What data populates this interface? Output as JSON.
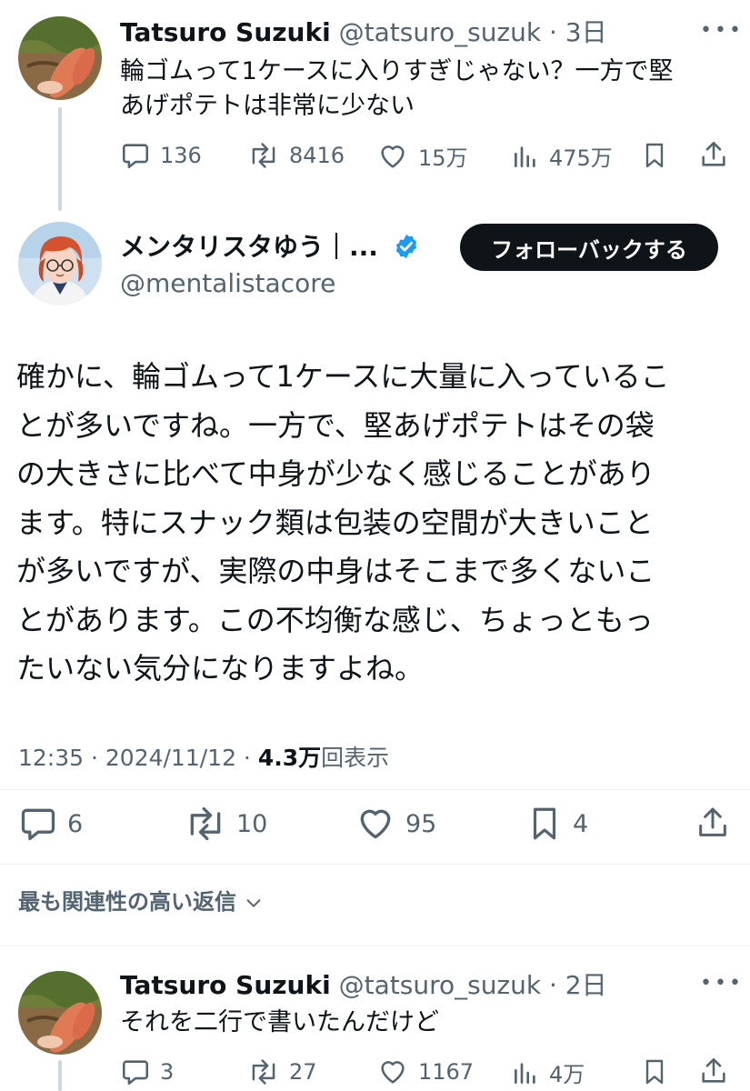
{
  "prev_tweet": {
    "author_name": "Tatsuro Suzuki",
    "handle": "@tatsuro_suzuk",
    "time": "· 3日",
    "text_lines": [
      "輪ゴムって1ケースに入りすぎじゃない？一方で堅",
      "あげポテトは非常に少ない"
    ],
    "actions": {
      "replies": "136",
      "reposts": "8416",
      "likes": "15万",
      "views": "475万"
    }
  },
  "main_tweet": {
    "author_name": "メンタリスタゆう｜...",
    "handle": "@mentalistacore",
    "follow_button": "フォローバックする",
    "text_lines": [
      "確かに、輪ゴムって1ケースに大量に入っているこ",
      "とが多いですね。一方で、堅あげポテトはその袋",
      "の大きさに比べて中身が少なく感じることがあり",
      "ます。特にスナック類は包装の空間が大きいこと",
      "が多いですが、実際の中身はそこまで多くないこ",
      "とがあります。この不均衡な感じ、ちょっともっ",
      "たいない気分になりますよね。"
    ],
    "meta": {
      "time": "12:35 · 2024/11/12 · ",
      "views_count": "4.3万",
      "views_label": "回表示"
    },
    "actions": {
      "replies": "6",
      "reposts": "10",
      "likes": "95",
      "bookmarks": "4"
    }
  },
  "sort_label": "最も関連性の高い返信",
  "reply_tweet": {
    "author_name": "Tatsuro Suzuki",
    "handle": "@tatsuro_suzuk",
    "time": "· 2日",
    "text": "それを二行で書いたんだけど",
    "actions": {
      "replies": "3",
      "reposts": "27",
      "likes": "1167",
      "views": "4万"
    }
  },
  "colors": {
    "text": "#0f1419",
    "muted": "#536471",
    "verified": "#1d9bf0",
    "button_bg": "#0f1419"
  }
}
